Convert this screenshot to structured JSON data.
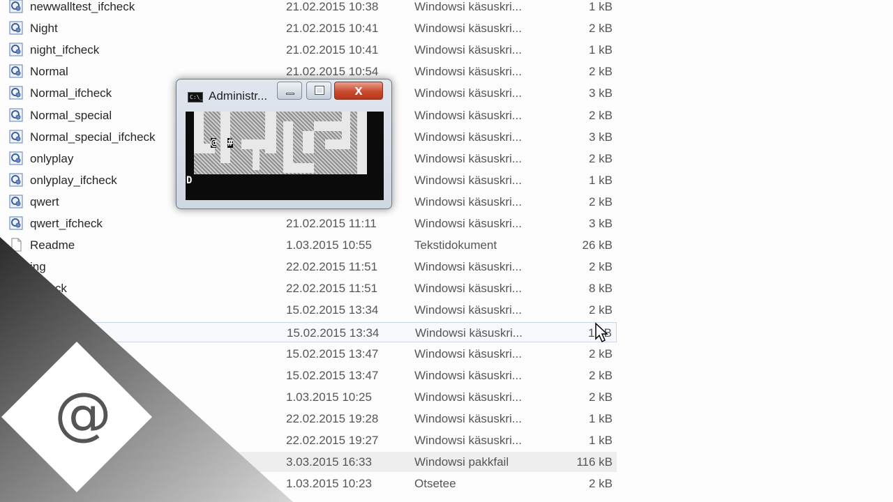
{
  "file_list": {
    "rows": [
      {
        "name": "newwalltest_ifcheck",
        "date": "21.02.2015 10:38",
        "type": "Windowsi käsuskri...",
        "size": "1 kB",
        "icon": "batch-file-icon"
      },
      {
        "name": "Night",
        "date": "21.02.2015 10:41",
        "type": "Windowsi käsuskri...",
        "size": "2 kB",
        "icon": "batch-file-icon"
      },
      {
        "name": "night_ifcheck",
        "date": "21.02.2015 10:41",
        "type": "Windowsi käsuskri...",
        "size": "1 kB",
        "icon": "batch-file-icon"
      },
      {
        "name": "Normal",
        "date": "21.02.2015 10:54",
        "type": "Windowsi käsuskri...",
        "size": "2 kB",
        "icon": "batch-file-icon"
      },
      {
        "name": "Normal_ifcheck",
        "date": "",
        "type": "Windowsi käsuskri...",
        "size": "3 kB",
        "icon": "batch-file-icon"
      },
      {
        "name": "Normal_special",
        "date": "",
        "type": "Windowsi käsuskri...",
        "size": "2 kB",
        "icon": "batch-file-icon"
      },
      {
        "name": "Normal_special_ifcheck",
        "date": "",
        "type": "Windowsi käsuskri...",
        "size": "3 kB",
        "icon": "batch-file-icon"
      },
      {
        "name": "onlyplay",
        "date": "",
        "type": "Windowsi käsuskri...",
        "size": "2 kB",
        "icon": "batch-file-icon"
      },
      {
        "name": "onlyplay_ifcheck",
        "date": "",
        "type": "Windowsi käsuskri...",
        "size": "1 kB",
        "icon": "batch-file-icon"
      },
      {
        "name": "qwert",
        "date": "",
        "type": "Windowsi käsuskri...",
        "size": "2 kB",
        "icon": "batch-file-icon"
      },
      {
        "name": "qwert_ifcheck",
        "date": "21.02.2015 11:11",
        "type": "Windowsi käsuskri...",
        "size": "3 kB",
        "icon": "batch-file-icon"
      },
      {
        "name": "Readme",
        "date": "1.03.2015 10:55",
        "type": "Tekstidokument",
        "size": "26 kB",
        "icon": "text-file-icon"
      },
      {
        "name": "ing",
        "date": "22.02.2015 11:51",
        "type": "Windowsi käsuskri...",
        "size": "2 kB",
        "icon": ""
      },
      {
        "name": "ifcheck",
        "date": "22.02.2015 11:51",
        "type": "Windowsi käsuskri...",
        "size": "8 kB",
        "icon": ""
      },
      {
        "name": "",
        "date": "15.02.2015 13:34",
        "type": "Windowsi käsuskri...",
        "size": "2 kB",
        "icon": ""
      },
      {
        "name": "",
        "date": "15.02.2015 13:34",
        "type": "Windowsi käsuskri...",
        "size": "1 kB",
        "icon": ""
      },
      {
        "name": "",
        "date": "15.02.2015 13:47",
        "type": "Windowsi käsuskri...",
        "size": "2 kB",
        "icon": ""
      },
      {
        "name": "",
        "date": "15.02.2015 13:47",
        "type": "Windowsi käsuskri...",
        "size": "2 kB",
        "icon": ""
      },
      {
        "name": "",
        "date": "1.03.2015 10:25",
        "type": "Windowsi käsuskri...",
        "size": "2 kB",
        "icon": ""
      },
      {
        "name": "",
        "date": "22.02.2015 19:28",
        "type": "Windowsi käsuskri...",
        "size": "1 kB",
        "icon": ""
      },
      {
        "name": "",
        "date": "22.02.2015 19:27",
        "type": "Windowsi käsuskri...",
        "size": "1 kB",
        "icon": ""
      },
      {
        "name": "",
        "date": "3.03.2015 16:33",
        "type": "Windowsi pakkfail",
        "size": "116 kB",
        "icon": ""
      },
      {
        "name": "",
        "date": "1.03.2015 10:23",
        "type": "Otsetee",
        "size": "2 kB",
        "icon": ""
      }
    ]
  },
  "cmd_window": {
    "title": "Administr...",
    "icon_label": "C:\\_",
    "close_label": "x",
    "console": {
      "player_char": "@",
      "wall_char": "#",
      "line_char": "D"
    }
  },
  "logo": {
    "symbol": "@",
    "colors": {
      "diamond": "#ffffff",
      "band_dark": "#3a3a3a",
      "band_light": "#bdbdbd",
      "symbol": "#555555"
    }
  },
  "colors": {
    "hover_row_border": "#c9d7ea",
    "close_button": "#c94a2d",
    "console_bg": "#0b0b0b"
  }
}
